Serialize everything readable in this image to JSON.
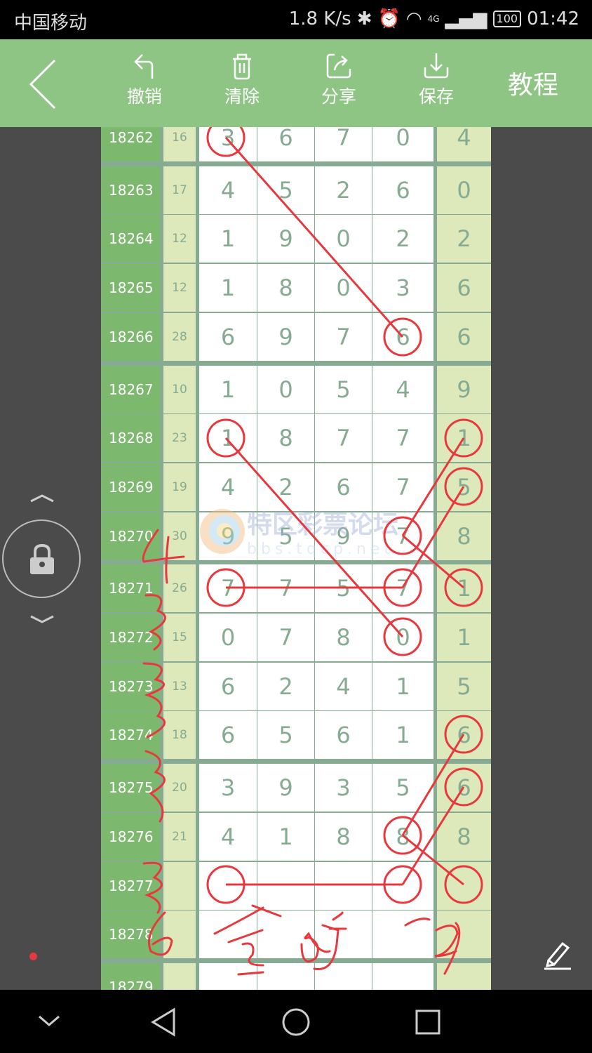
{
  "status_bar": {
    "carrier": "中国移动",
    "speed": "1.8 K/s",
    "network": "4G",
    "battery": "100",
    "time": "01:42"
  },
  "header": {
    "back_icon": "chevron-left-icon",
    "buttons": [
      {
        "label": "撤销",
        "icon": "undo-icon"
      },
      {
        "label": "清除",
        "icon": "trash-icon"
      },
      {
        "label": "分享",
        "icon": "share-icon"
      },
      {
        "label": "保存",
        "icon": "download-icon"
      }
    ],
    "tutorial": "教程"
  },
  "watermark": {
    "name": "特区彩票论坛",
    "url": "bbs.tqcp.net"
  },
  "rows": [
    {
      "id": "18262",
      "sum": "16",
      "nums": [
        "3",
        "6",
        "7",
        "0"
      ],
      "last": "4"
    },
    {
      "id": "18263",
      "sum": "17",
      "nums": [
        "4",
        "5",
        "2",
        "6"
      ],
      "last": "0"
    },
    {
      "id": "18264",
      "sum": "12",
      "nums": [
        "1",
        "9",
        "0",
        "2"
      ],
      "last": "2"
    },
    {
      "id": "18265",
      "sum": "12",
      "nums": [
        "1",
        "8",
        "0",
        "3"
      ],
      "last": "6"
    },
    {
      "id": "18266",
      "sum": "28",
      "nums": [
        "6",
        "9",
        "7",
        "6"
      ],
      "last": "6"
    },
    {
      "id": "18267",
      "sum": "10",
      "nums": [
        "1",
        "0",
        "5",
        "4"
      ],
      "last": "9"
    },
    {
      "id": "18268",
      "sum": "23",
      "nums": [
        "1",
        "8",
        "7",
        "7"
      ],
      "last": "1"
    },
    {
      "id": "18269",
      "sum": "19",
      "nums": [
        "4",
        "2",
        "6",
        "7"
      ],
      "last": "5"
    },
    {
      "id": "18270",
      "sum": "30",
      "nums": [
        "9",
        "5",
        "9",
        "7"
      ],
      "last": "8"
    },
    {
      "id": "18271",
      "sum": "26",
      "nums": [
        "7",
        "7",
        "5",
        "7"
      ],
      "last": "1"
    },
    {
      "id": "18272",
      "sum": "15",
      "nums": [
        "0",
        "7",
        "8",
        "0"
      ],
      "last": "1"
    },
    {
      "id": "18273",
      "sum": "13",
      "nums": [
        "6",
        "2",
        "4",
        "1"
      ],
      "last": "5"
    },
    {
      "id": "18274",
      "sum": "18",
      "nums": [
        "6",
        "5",
        "6",
        "1"
      ],
      "last": "6"
    },
    {
      "id": "18275",
      "sum": "20",
      "nums": [
        "3",
        "9",
        "3",
        "5"
      ],
      "last": "6"
    },
    {
      "id": "18276",
      "sum": "21",
      "nums": [
        "4",
        "1",
        "8",
        "8"
      ],
      "last": "8"
    },
    {
      "id": "18277",
      "sum": "",
      "nums": [
        "",
        "",
        "",
        ""
      ],
      "last": ""
    },
    {
      "id": "18278",
      "sum": "",
      "nums": [
        "",
        "",
        "",
        ""
      ],
      "last": ""
    },
    {
      "id": "18279",
      "sum": "",
      "nums": [
        "",
        "",
        "",
        ""
      ],
      "last": ""
    }
  ],
  "annotation_color": "#e8383d",
  "side": {
    "lock_icon": "lock-icon",
    "pencil_icon": "pencil-icon"
  },
  "colors": {
    "header": "#8fc584",
    "id_column": "#7db86f",
    "digit": "#86ab92",
    "annotation": "#e8383d"
  }
}
